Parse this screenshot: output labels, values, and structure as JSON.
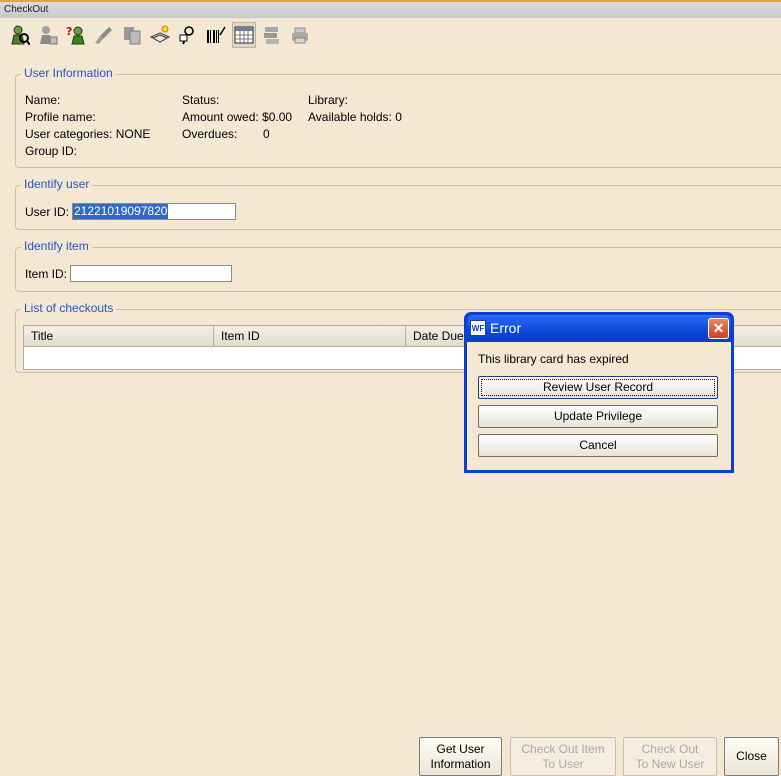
{
  "window": {
    "title": "CheckOut"
  },
  "toolbar": {
    "icons": [
      "user-search-icon",
      "user-info-icon",
      "user-help-icon",
      "brush-icon",
      "copy-icon",
      "book-new-icon",
      "reader-icon",
      "barcode-icon",
      "calendar-icon",
      "stack-icon",
      "printer-icon"
    ]
  },
  "user_info": {
    "legend": "User Information",
    "name_label": "Name:",
    "profile_label": "Profile name:",
    "categories_label": "User categories:",
    "categories_value": "NONE",
    "group_label": "Group ID:",
    "status_label": "Status:",
    "owed_label": "Amount owed:",
    "owed_value": "$0.00",
    "overdues_label": "Overdues:",
    "overdues_value": "0",
    "library_label": "Library:",
    "holds_label": "Available holds:",
    "holds_value": "0"
  },
  "identify_user": {
    "legend": "Identify user",
    "label": "User ID:",
    "value": "21221019097820"
  },
  "identify_item": {
    "legend": "Identify item",
    "label": "Item ID:",
    "value": ""
  },
  "checkouts": {
    "legend": "List of checkouts",
    "columns": [
      "Title",
      "Item ID",
      "Date Due"
    ]
  },
  "dialog": {
    "icon_text": "WF",
    "title": "Error",
    "close": "✕",
    "message": "This library card has expired",
    "buttons": [
      "Review User Record",
      "Update Privilege",
      "Cancel"
    ]
  },
  "bottom_buttons": {
    "get_user_info": [
      "Get User",
      "Information"
    ],
    "checkout_to_user": [
      "Check Out Item",
      "To User"
    ],
    "checkout_new_user": [
      "Check Out",
      "To New User"
    ],
    "close": "Close"
  },
  "colors": {
    "background": "#f5e8d2",
    "legend": "#2353c9",
    "selection": "#316ac5",
    "dialog_frame": "#0a3fd6"
  }
}
